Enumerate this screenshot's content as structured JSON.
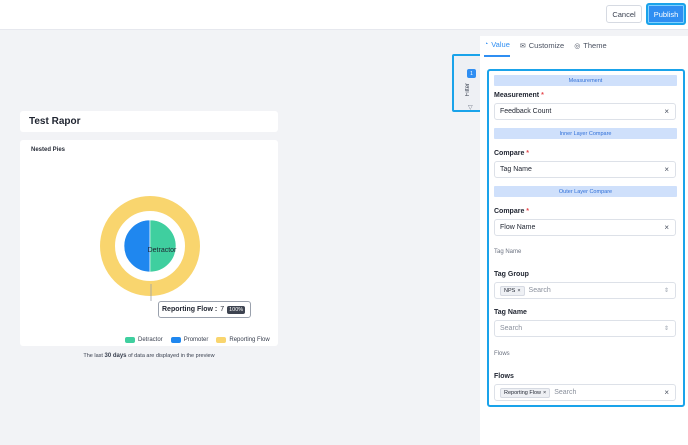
{
  "header": {
    "cancel_label": "Cancel",
    "publish_label": "Publish"
  },
  "report": {
    "title": "Test Rapor",
    "chart_title": "Nested Pies"
  },
  "chart_data": {
    "type": "pie",
    "title": "Nested Pies",
    "inner": {
      "series": [
        {
          "name": "Promoter",
          "value": 50,
          "color": "#1f87ef"
        },
        {
          "name": "Detractor",
          "value": 50,
          "color": "#3fcf9f"
        }
      ],
      "center_label": "Detractor"
    },
    "outer": {
      "series": [
        {
          "name": "Reporting Flow",
          "value": 100,
          "color": "#f9d56e"
        }
      ]
    },
    "legend": [
      {
        "name": "Detractor",
        "color": "#3fcf9f"
      },
      {
        "name": "Promoter",
        "color": "#1f87ef"
      },
      {
        "name": "Reporting Flow",
        "color": "#f9d56e"
      }
    ],
    "legend_position": "bottom-right"
  },
  "tooltip": {
    "label": "Reporting Flow :",
    "value": "7",
    "percent": "100%"
  },
  "footnote": {
    "prefix": "The last",
    "bold": "30 days",
    "suffix": "of data are displayed in the preview"
  },
  "filter": {
    "badge": "1",
    "label": "Filter"
  },
  "tabs": [
    {
      "label": "Value",
      "icon": "value-icon"
    },
    {
      "label": "Customize",
      "icon": "envelope-icon"
    },
    {
      "label": "Theme",
      "icon": "theme-icon"
    }
  ],
  "form": {
    "section_measurement": "Measurement",
    "measurement_label": "Measurement",
    "measurement_value": "Feedback Count",
    "section_inner": "Inner Layer Compare",
    "compare_inner_label": "Compare",
    "compare_inner_value": "Tag Name",
    "section_outer": "Outer Layer Compare",
    "compare_outer_label": "Compare",
    "compare_outer_value": "Flow Name",
    "tag_name_caption": "Tag Name",
    "tag_group_label": "Tag Group",
    "tag_group_chip": "NPS",
    "tag_group_placeholder": "Search",
    "tag_name_label": "Tag Name",
    "tag_name_placeholder": "Search",
    "flows_caption": "Flows",
    "flows_label": "Flows",
    "flows_chip": "Reporting Flow",
    "flows_placeholder": "Search",
    "required_mark": "*"
  }
}
